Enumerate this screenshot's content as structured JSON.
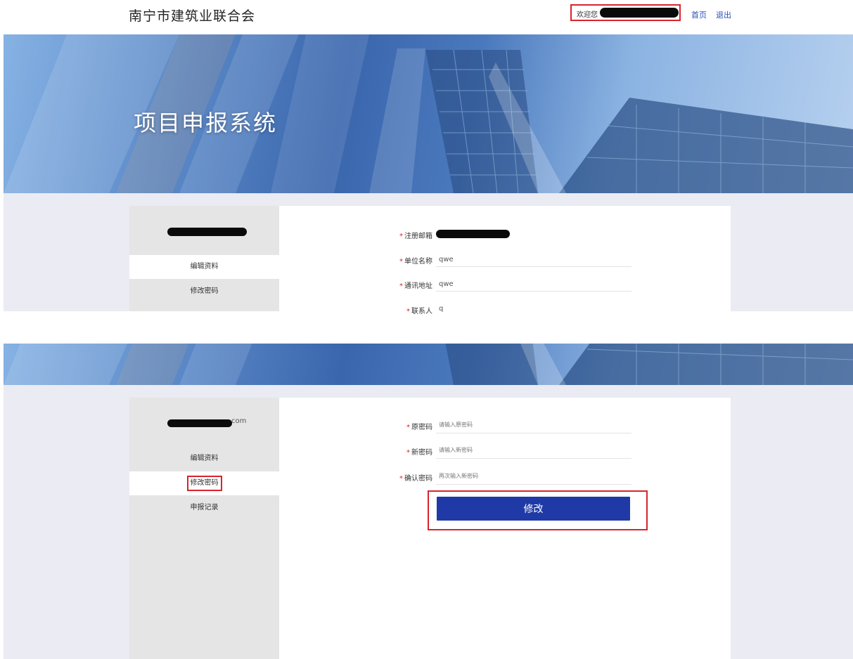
{
  "header": {
    "site_title": "南宁市建筑业联合会",
    "welcome_text": "欢迎您",
    "nav": {
      "home": "首页",
      "logout": "退出"
    }
  },
  "banner": {
    "title": "项目申报系统"
  },
  "panel1": {
    "sidebar": {
      "items": [
        "编辑资料",
        "修改密码"
      ],
      "active": "编辑资料"
    },
    "form": {
      "fields": [
        {
          "label": "注册邮箱",
          "required": true,
          "value": ""
        },
        {
          "label": "单位名称",
          "required": true,
          "value": "qwe"
        },
        {
          "label": "通讯地址",
          "required": true,
          "value": "qwe"
        },
        {
          "label": "联系人",
          "required": true,
          "value": "q"
        }
      ]
    }
  },
  "panel2": {
    "sidebar": {
      "email_suffix": "com",
      "items": [
        "编辑资料",
        "修改密码",
        "申报记录"
      ],
      "active": "修改密码"
    },
    "form": {
      "fields": [
        {
          "label": "原密码",
          "required": true,
          "placeholder": "请输入原密码"
        },
        {
          "label": "新密码",
          "required": true,
          "placeholder": "请输入新密码"
        },
        {
          "label": "确认密码",
          "required": true,
          "placeholder": "再次输入新密码"
        }
      ],
      "submit_label": "修改"
    }
  },
  "colors": {
    "accent": "#1f3aa6",
    "highlight_border": "#d8242c",
    "link": "#2a4fb8",
    "page_bg": "#eaebf3",
    "sidebar_bg": "#e5e5e5"
  }
}
